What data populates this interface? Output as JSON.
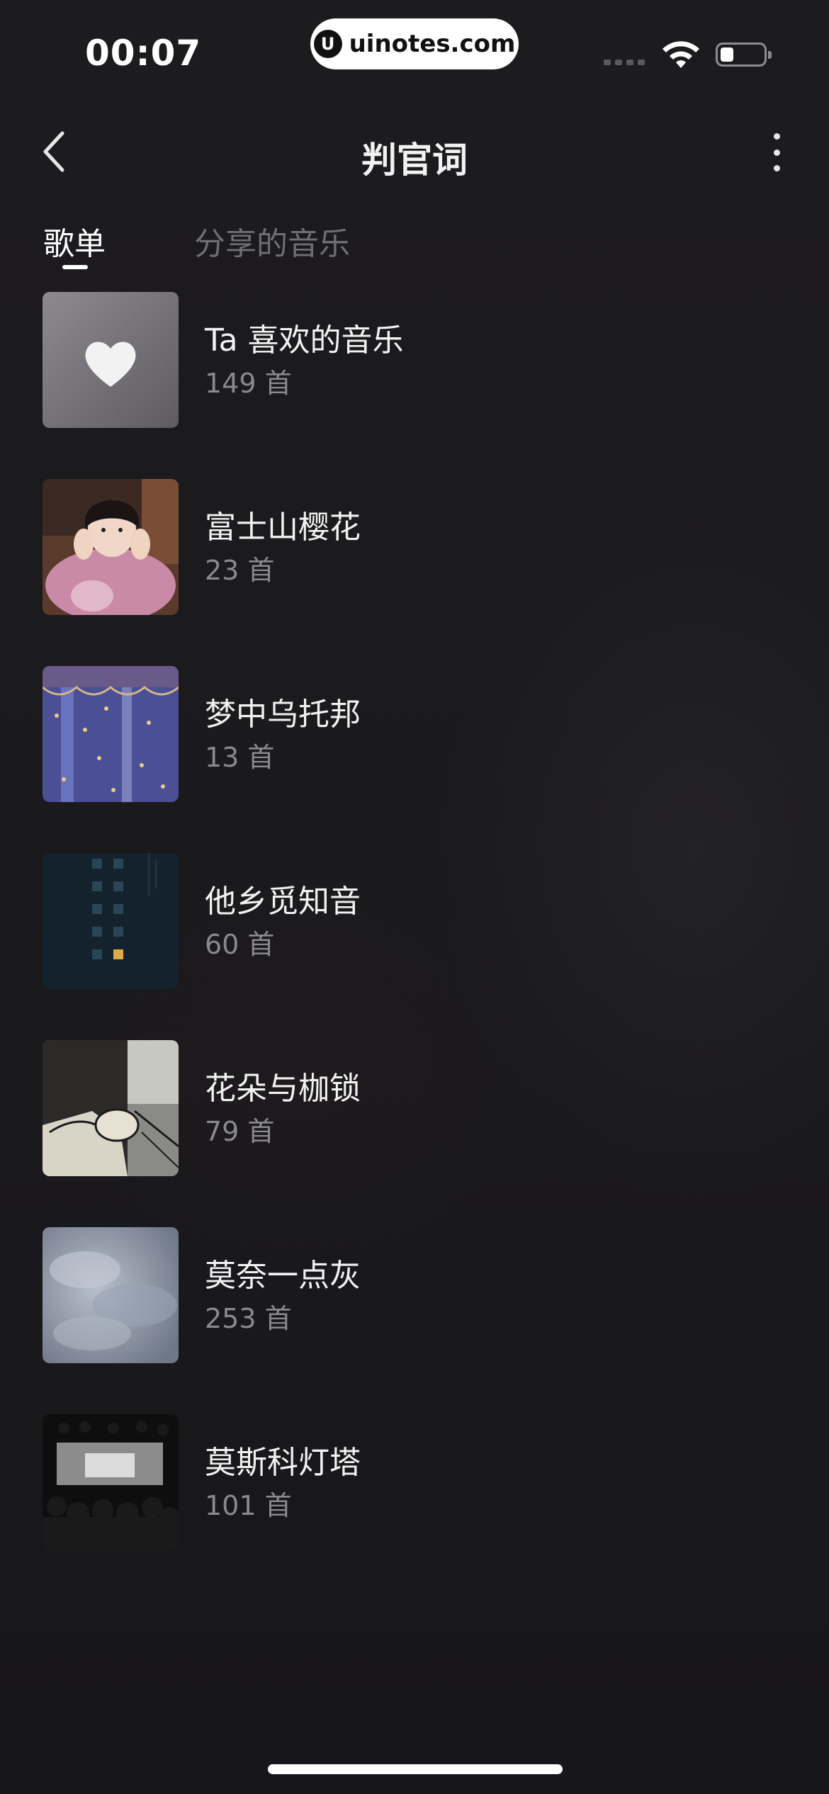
{
  "status_bar": {
    "time": "00:07",
    "watermark": "uinotes.com",
    "watermark_logo": "U",
    "battery_level": 0.3
  },
  "nav": {
    "title": "判官词"
  },
  "tabs": [
    {
      "label": "歌单",
      "active": true
    },
    {
      "label": "分享的音乐",
      "active": false
    }
  ],
  "playlists": [
    {
      "title": "Ta 喜欢的音乐",
      "count": "149 首",
      "cover": "heart-cover"
    },
    {
      "title": "富士山樱花",
      "count": "23 首",
      "cover": "portrait-cover"
    },
    {
      "title": "梦中乌托邦",
      "count": "13 首",
      "cover": "starry-curtain-cover"
    },
    {
      "title": "他乡觅知音",
      "count": "60 首",
      "cover": "night-building-cover"
    },
    {
      "title": "花朵与枷锁",
      "count": "79 首",
      "cover": "sketch-hands-cover"
    },
    {
      "title": "莫奈一点灰",
      "count": "253 首",
      "cover": "grey-clouds-cover"
    },
    {
      "title": "莫斯科灯塔",
      "count": "101 首",
      "cover": "crowd-screen-cover"
    }
  ],
  "colors": {
    "background": "#1b1a1c",
    "text_primary": "#f2f2f2",
    "text_secondary": "#8a898d",
    "tab_inactive": "#6f6e72"
  }
}
